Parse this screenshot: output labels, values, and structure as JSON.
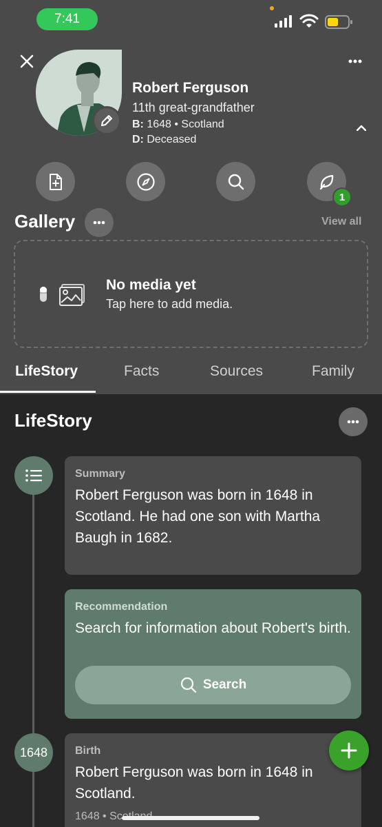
{
  "status_bar": {
    "time": "7:41"
  },
  "profile": {
    "name": "Robert Ferguson",
    "relationship": "11th great-grandfather",
    "birth_label": "B:",
    "birth_value": "1648 • Scotland",
    "death_label": "D:",
    "death_value": "Deceased"
  },
  "quick_actions": {
    "hints_badge": "1"
  },
  "gallery": {
    "title": "Gallery",
    "view_all": "View all",
    "empty_title": "No media yet",
    "empty_subtitle": "Tap here to add media."
  },
  "tabs": [
    {
      "label": "LifeStory",
      "active": true
    },
    {
      "label": "Facts"
    },
    {
      "label": "Sources"
    },
    {
      "label": "Family"
    }
  ],
  "lifestory": {
    "title": "LifeStory",
    "summary": {
      "label": "Summary",
      "text": "Robert Ferguson was born in 1648 in Scotland. He had one son with Martha Baugh in 1682."
    },
    "recommendation": {
      "label": "Recommendation",
      "text": "Search for information about Robert's birth.",
      "button": "Search"
    },
    "birth": {
      "year": "1648",
      "label": "Birth",
      "text": "Robert Ferguson was born in 1648 in Scotland.",
      "meta": "1648 • Scotland"
    }
  },
  "colors": {
    "header_bg": "#4a4a4a",
    "body_bg": "#262626",
    "accent_green": "#3aa12a",
    "sage": "#5e7b6c"
  }
}
